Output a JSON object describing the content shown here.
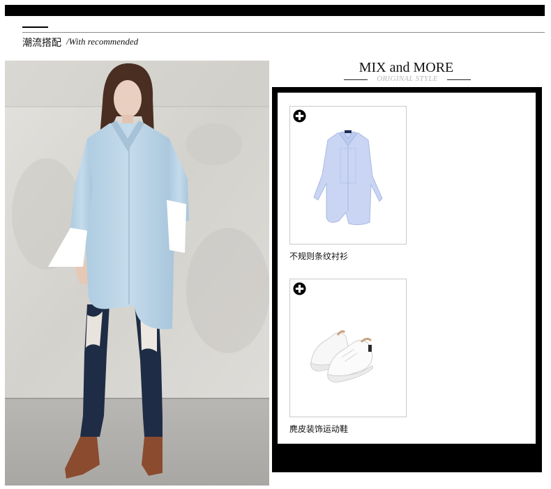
{
  "section": {
    "title_cn": "潮流搭配",
    "title_en": "/With recommended"
  },
  "panel": {
    "title": "MIX and MORE",
    "subtitle": "ORIGINAL STYLE"
  },
  "products": [
    {
      "name": "不规则条纹衬衫",
      "icon": "plus-circle-icon"
    },
    {
      "name": "麂皮装饰运动鞋",
      "icon": "plus-circle-icon"
    }
  ],
  "colors": {
    "bar": "#000000",
    "shirt": "#b9d3e6",
    "jeans": "#1e2b44",
    "shoes": "#8a4b2f"
  }
}
